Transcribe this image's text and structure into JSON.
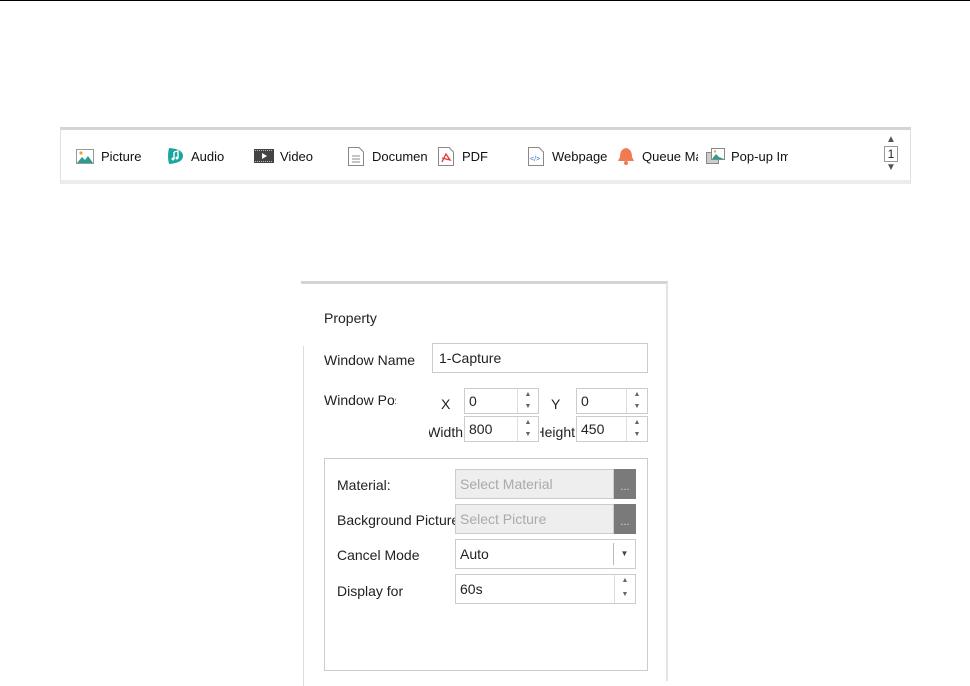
{
  "toolbar": {
    "items": [
      {
        "label": "Picture",
        "icon": "picture-icon"
      },
      {
        "label": "Audio",
        "icon": "audio-icon"
      },
      {
        "label": "Video",
        "icon": "video-icon"
      },
      {
        "label": "Document",
        "icon": "document-icon"
      },
      {
        "label": "PDF",
        "icon": "pdf-icon"
      },
      {
        "label": "Webpage",
        "icon": "webpage-icon"
      },
      {
        "label": "Queue Management",
        "icon": "bell-icon"
      },
      {
        "label": "Pop-up Image",
        "icon": "popup-image-icon"
      }
    ],
    "page": "1",
    "colors": {
      "audio": "#1aa6a0",
      "bell": "#f07b50",
      "pdf": "#e0363a"
    }
  },
  "panel": {
    "title": "Property",
    "window_name_label": "Window Name",
    "window_name_value": "1-Capture",
    "window_pos_label": "Window Position",
    "x_label": "X",
    "x_value": "0",
    "y_label": "Y",
    "y_value": "0",
    "width_label": "Width",
    "width_value": "800",
    "height_label": "Height",
    "height_value": "450",
    "material_label": "Material:",
    "material_placeholder": "Select Material",
    "bg_label": "Background Picture",
    "bg_placeholder": "Select Picture",
    "browse": "...",
    "cancel_mode_label": "Cancel Mode",
    "cancel_mode_value": "Auto",
    "display_for_label": "Display for",
    "display_for_value": "60s"
  }
}
